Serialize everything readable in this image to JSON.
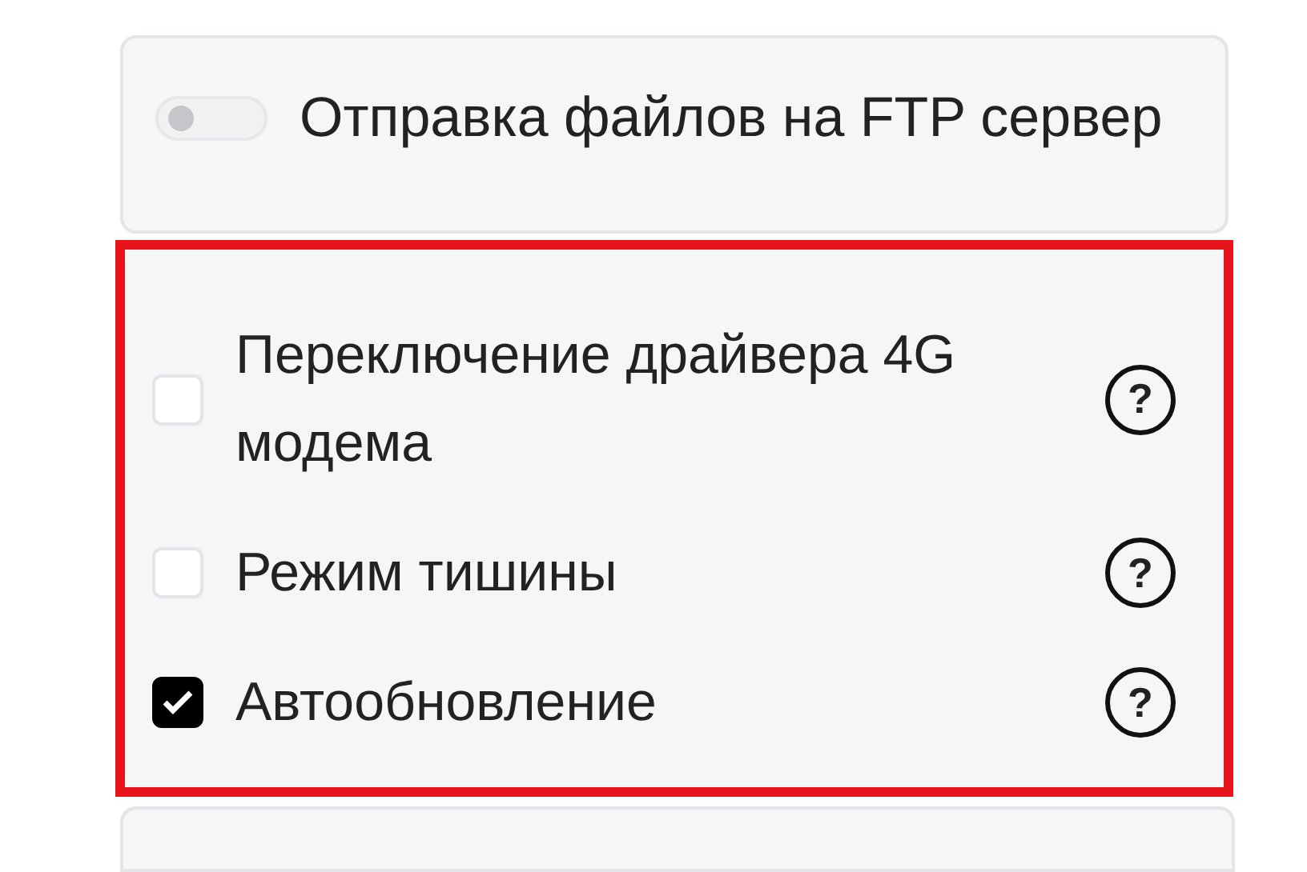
{
  "ftp_card": {
    "toggle": {
      "label": "Отправка файлов на FTP сервер",
      "on": false
    }
  },
  "options_panel": {
    "highlighted": true,
    "options": [
      {
        "label": "Переключение драйвера 4G модема",
        "checked": false,
        "help": "?"
      },
      {
        "label": "Режим тишины",
        "checked": false,
        "help": "?"
      },
      {
        "label": "Автообновление",
        "checked": true,
        "help": "?"
      }
    ]
  }
}
